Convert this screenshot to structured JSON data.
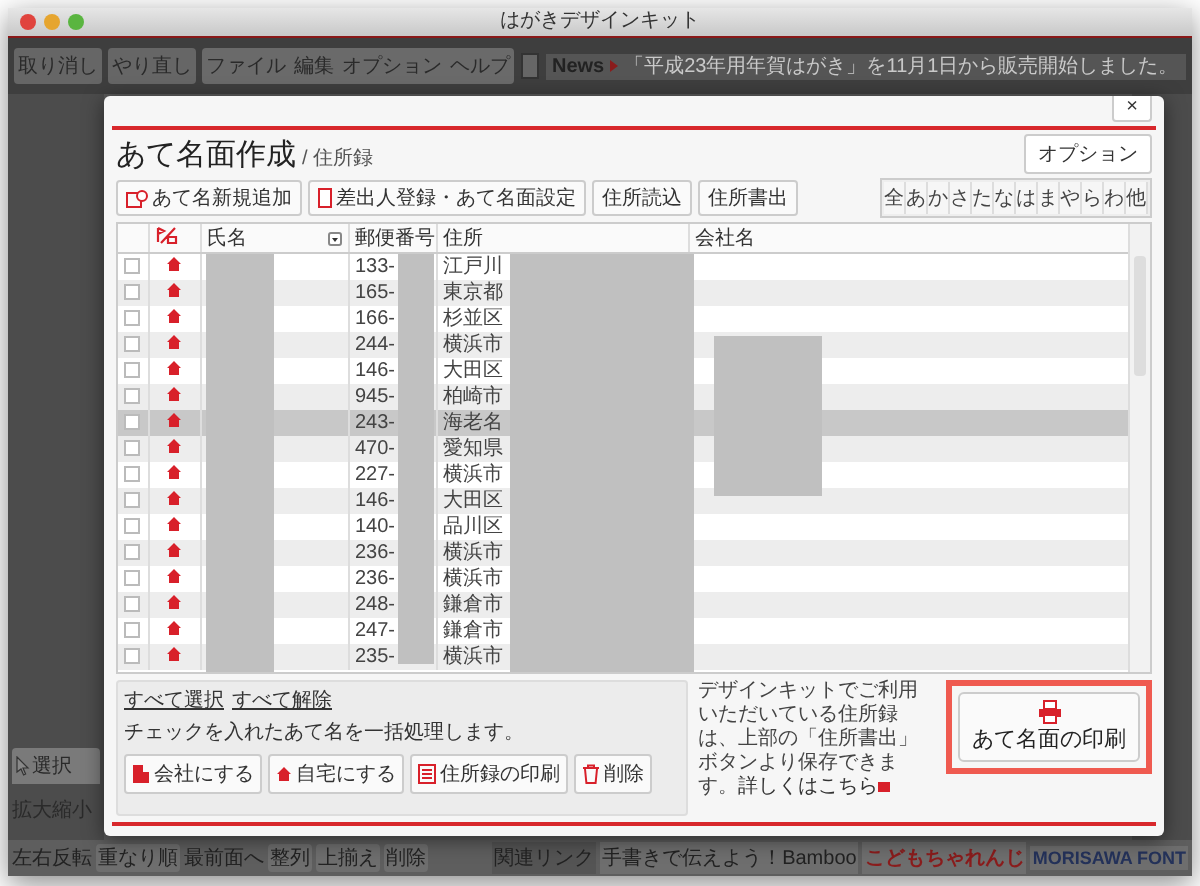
{
  "window": {
    "title": "はがきデザインキット"
  },
  "toolbar": {
    "edit_buttons": [
      "取り消し",
      "やり直し"
    ],
    "menu": [
      "ファイル",
      "編集",
      "オプション",
      "ヘルプ"
    ],
    "news_label": "News",
    "news_text": "「平成23年用年賀はがき」を11月1日から販売開始しました。"
  },
  "left_panel": {
    "tabs": [
      {
        "label": "選択",
        "selected": true
      }
    ],
    "zoom_label": "拡大縮小"
  },
  "bottom_bar": {
    "tools": [
      "左右反転",
      "重なり順",
      "最前面へ",
      "整列",
      "上揃え",
      "削除"
    ],
    "links_label": "関連リンク",
    "links": [
      "手書きで伝えよう！Bamboo",
      "こどもちゃれんじ",
      "MORISAWA FONT"
    ]
  },
  "dialog": {
    "close": "×",
    "title": "あて名面作成",
    "subtitle": "/ 住所録",
    "option_button": "オプション",
    "actions": [
      "あて名新規追加",
      "差出人登録・あて名面設定",
      "住所読込",
      "住所書出"
    ],
    "kana_filter": [
      {
        "label": "全",
        "selected": false
      },
      {
        "label": "あ",
        "selected": false
      },
      {
        "label": "か",
        "selected": false
      },
      {
        "label": "さ",
        "selected": false
      },
      {
        "label": "た",
        "selected": false
      },
      {
        "label": "な",
        "selected": false
      },
      {
        "label": "は",
        "selected": false
      },
      {
        "label": "ま",
        "selected": false
      },
      {
        "label": "や",
        "selected": false
      },
      {
        "label": "ら",
        "selected": false
      },
      {
        "label": "わ",
        "selected": false
      },
      {
        "label": "他",
        "selected": false
      }
    ],
    "table": {
      "columns": [
        "氏名",
        "郵便番号",
        "住所",
        "会社名"
      ],
      "rows": [
        {
          "postal": "133-",
          "address": "江戸川",
          "checked": false,
          "selected": false
        },
        {
          "postal": "165-",
          "address": "東京都",
          "checked": false,
          "selected": false
        },
        {
          "postal": "166-",
          "address": "杉並区",
          "checked": false,
          "selected": false
        },
        {
          "postal": "244-",
          "address": "横浜市",
          "checked": false,
          "selected": false
        },
        {
          "postal": "146-",
          "address": "大田区",
          "checked": false,
          "selected": false
        },
        {
          "postal": "945-",
          "address": "柏崎市",
          "checked": false,
          "selected": false
        },
        {
          "postal": "243-",
          "address": "海老名",
          "checked": false,
          "selected": true
        },
        {
          "postal": "470-",
          "address": "愛知県",
          "checked": false,
          "selected": false
        },
        {
          "postal": "227-",
          "address": "横浜市",
          "checked": false,
          "selected": false
        },
        {
          "postal": "146-",
          "address": "大田区",
          "checked": false,
          "selected": false
        },
        {
          "postal": "140-",
          "address": "品川区",
          "checked": false,
          "selected": false
        },
        {
          "postal": "236-",
          "address": "横浜市",
          "checked": false,
          "selected": false
        },
        {
          "postal": "236-",
          "address": "横浜市",
          "checked": false,
          "selected": false
        },
        {
          "postal": "248-",
          "address": "鎌倉市",
          "checked": false,
          "selected": false
        },
        {
          "postal": "247-",
          "address": "鎌倉市",
          "checked": false,
          "selected": false
        },
        {
          "postal": "235-",
          "address": "横浜市",
          "checked": false,
          "selected": false
        }
      ]
    },
    "bulk": {
      "links": [
        "すべて選択",
        "すべて解除"
      ],
      "hint": "チェックを入れたあて名を一括処理します。",
      "buttons": [
        {
          "kind": "company",
          "label": "会社にする"
        },
        {
          "kind": "home",
          "label": "自宅にする"
        },
        {
          "kind": "list",
          "label": "住所録の印刷"
        },
        {
          "kind": "trash",
          "label": "削除"
        }
      ]
    },
    "note": {
      "text": "デザインキットでご利用いただいている住所録は、上部の「住所書出」ボタンより保存できます。",
      "link": "詳しくはこちら"
    },
    "print_button": "あて名面の印刷"
  }
}
